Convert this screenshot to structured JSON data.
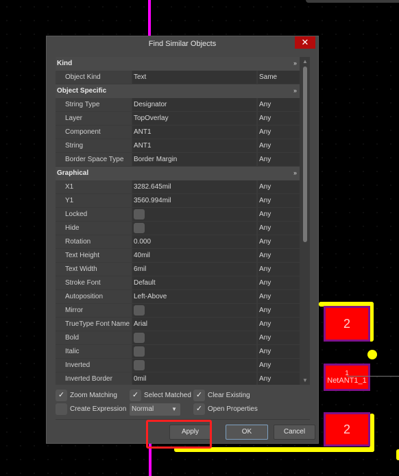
{
  "dialog": {
    "title": "Find Similar Objects",
    "close_label": "✕"
  },
  "rows": [
    {
      "type": "header",
      "label": "Kind"
    },
    {
      "label": "Object Kind",
      "value": "Text",
      "mode": "Same"
    },
    {
      "type": "header",
      "label": "Object Specific"
    },
    {
      "label": "String Type",
      "value": "Designator",
      "mode": "Any"
    },
    {
      "label": "Layer",
      "value": "TopOverlay",
      "mode": "Any"
    },
    {
      "label": "Component",
      "value": "ANT1",
      "mode": "Any"
    },
    {
      "label": "String",
      "value": "ANT1",
      "mode": "Any"
    },
    {
      "label": "Border Space Type",
      "value": "Border Margin",
      "mode": "Any"
    },
    {
      "type": "header",
      "label": "Graphical"
    },
    {
      "label": "X1",
      "value": "3282.645mil",
      "mode": "Any"
    },
    {
      "label": "Y1",
      "value": "3560.994mil",
      "mode": "Any"
    },
    {
      "label": "Locked",
      "checkbox": false,
      "mode": "Any"
    },
    {
      "label": "Hide",
      "checkbox": false,
      "mode": "Any"
    },
    {
      "label": "Rotation",
      "value": "0.000",
      "mode": "Any"
    },
    {
      "label": "Text Height",
      "value": "40mil",
      "mode": "Any"
    },
    {
      "label": "Text Width",
      "value": "6mil",
      "mode": "Any"
    },
    {
      "label": "Stroke Font",
      "value": "Default",
      "mode": "Any"
    },
    {
      "label": "Autoposition",
      "value": "Left-Above",
      "mode": "Any"
    },
    {
      "label": "Mirror",
      "checkbox": false,
      "mode": "Any"
    },
    {
      "label": "TrueType Font Name",
      "value": "Arial",
      "mode": "Any"
    },
    {
      "label": "Bold",
      "checkbox": false,
      "mode": "Any"
    },
    {
      "label": "Italic",
      "checkbox": false,
      "mode": "Any"
    },
    {
      "label": "Inverted",
      "checkbox": false,
      "mode": "Any"
    },
    {
      "label": "Inverted Border Width",
      "value": "0mil",
      "mode": "Any"
    }
  ],
  "options": {
    "zoom_matching": {
      "label": "Zoom Matching",
      "checked": true
    },
    "select_matched": {
      "label": "Select Matched",
      "checked": true
    },
    "clear_existing": {
      "label": "Clear Existing",
      "checked": true
    },
    "create_expression": {
      "label": "Create Expression",
      "checked": false
    },
    "mode_select": "Normal",
    "open_properties": {
      "label": "Open Properties",
      "checked": true
    }
  },
  "buttons": {
    "apply": "Apply",
    "ok": "OK",
    "cancel": "Cancel"
  },
  "pcb": {
    "pad_top": "2",
    "pad_mid_number": "1",
    "pad_mid_net": "NetANT1_1",
    "pad_bottom": "2"
  },
  "colors": {
    "pad": "#ff0000",
    "track": "#ffff00",
    "highlight": "#ff2020",
    "close": "#b30b0b"
  }
}
